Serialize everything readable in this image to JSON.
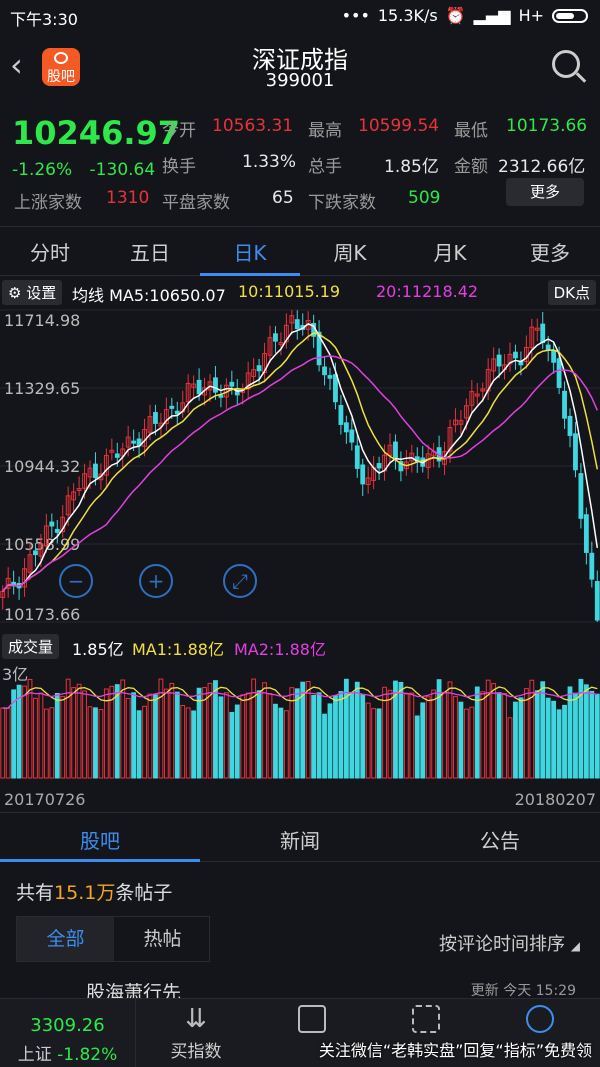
{
  "status": {
    "time": "下午3:30",
    "net": "15.3K/s",
    "signal": "H+"
  },
  "header": {
    "title": "深证成指",
    "code": "399001"
  },
  "logo_text": "股吧",
  "quote": {
    "price": "10246.97",
    "change_pct": "-1.26%",
    "change": "-130.64",
    "open_label": "今开",
    "open": "10563.31",
    "high_label": "最高",
    "high": "10599.54",
    "low_label": "最低",
    "low": "10173.66",
    "turnover_label": "换手",
    "turnover": "1.33%",
    "volume_label": "总手",
    "volume": "1.85亿",
    "amount_label": "金额",
    "amount": "2312.66亿",
    "up_label": "上涨家数",
    "up": "1310",
    "flat_label": "平盘家数",
    "flat": "65",
    "down_label": "下跌家数",
    "down": "509",
    "more": "更多"
  },
  "tabs": [
    "分时",
    "五日",
    "日K",
    "周K",
    "月K",
    "更多"
  ],
  "active_tab": "日K",
  "ma": {
    "settings": "设置",
    "label": "均线",
    "ma5": "MA5:10650.07",
    "ma10": "10:11015.19",
    "ma20": "20:11218.42",
    "dk": "DK点"
  },
  "vol": {
    "label": "成交量",
    "value": "1.85亿",
    "ma1": "MA1:1.88亿",
    "ma2": "MA2:1.88亿",
    "axis": "3亿"
  },
  "dates": {
    "start": "20170726",
    "end": "20180207"
  },
  "bottom_tabs": [
    "股吧",
    "新闻",
    "公告"
  ],
  "posts": {
    "prefix": "共有",
    "count": "15.1万",
    "suffix": "条帖子"
  },
  "filter": {
    "all": "全部",
    "hot": "热帖",
    "sort": "按评论时间排序"
  },
  "feed_preview": "股海萧行先",
  "feed_time": "更新 今天 15:29",
  "bottom_bar": {
    "index_value": "3309.26",
    "index_name": "上证",
    "index_pct": "-1.82%",
    "buy": "买指数"
  },
  "watermark": "关注微信“老韩实盘”回复“指标”免费领",
  "colors": {
    "up": "#e8323a",
    "down": "#2ee84a",
    "accent": "#3d8cf0",
    "down_candle": "#3fd6e0"
  },
  "chart_data": {
    "type": "candlestick",
    "y_ticks": [
      "11714.98",
      "11329.65",
      "10944.32",
      "10558.99",
      "10173.66"
    ],
    "ylim": [
      10173.66,
      11714.98
    ],
    "close_trend": [
      10300,
      10420,
      10560,
      10700,
      10850,
      10950,
      11000,
      11100,
      11150,
      11250,
      11320,
      11350,
      11280,
      11420,
      11520,
      11680,
      11600,
      11380,
      11050,
      10870,
      11000,
      10980,
      10950,
      11050,
      11200,
      11380,
      11450,
      11500,
      11620,
      11380,
      10800,
      10200
    ],
    "series": [
      {
        "name": "MA5"
      },
      {
        "name": "MA10"
      },
      {
        "name": "MA20"
      }
    ]
  }
}
